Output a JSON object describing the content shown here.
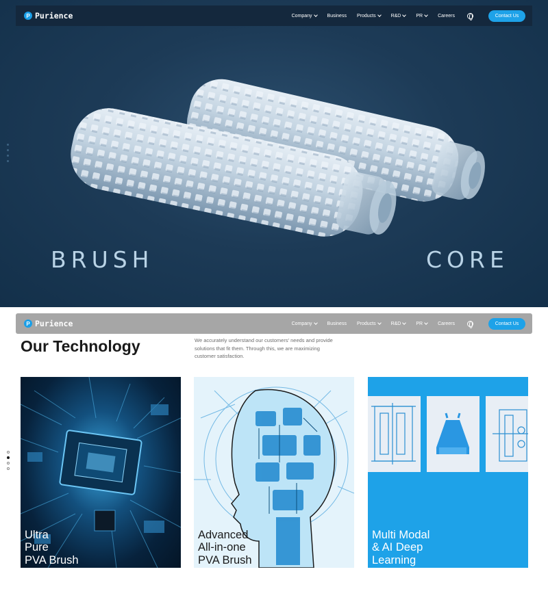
{
  "brand": {
    "name": "Purience",
    "logo_letter": "P"
  },
  "nav": {
    "items": [
      {
        "label": "Company",
        "dropdown": true
      },
      {
        "label": "Business",
        "dropdown": false
      },
      {
        "label": "Products",
        "dropdown": true
      },
      {
        "label": "R&D",
        "dropdown": true
      },
      {
        "label": "PR",
        "dropdown": true
      },
      {
        "label": "Careers",
        "dropdown": false
      }
    ],
    "language_icon": "globe-icon",
    "contact_label": "Contact Us"
  },
  "hero": {
    "left_word": "BRUSH",
    "right_word": "CORE",
    "image": "white PVA brush core rollers"
  },
  "technology": {
    "title": "Our Technology",
    "description": "We accurately understand our customers' needs and provide solutions that fit them.  Through this, we are maximizing customer satisfaction.",
    "cards": [
      {
        "label": "Ultra\nPure\nPVA Brush",
        "image": "circuit board chip"
      },
      {
        "label": "Advanced\nAll-in-one\nPVA Brush",
        "image": "circuit brain head"
      },
      {
        "label": "Multi Modal\n& AI Deep\nLearning",
        "image": "machine diagrams"
      }
    ]
  },
  "colors": {
    "accent": "#1ea2e8",
    "hero_bg": "#1d3b57",
    "nav_dark": "#14283d",
    "nav_sticky": "#a6a6a6"
  }
}
